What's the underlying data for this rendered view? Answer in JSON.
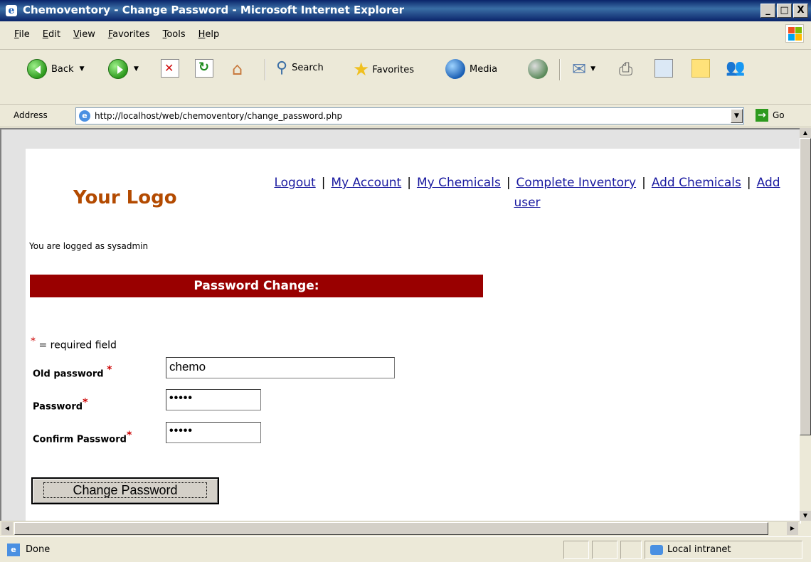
{
  "window": {
    "title": "Chemoventory - Change Password - Microsoft Internet Explorer",
    "minimize": "_",
    "maximize": "□",
    "close": "X"
  },
  "menu": [
    "File",
    "Edit",
    "View",
    "Favorites",
    "Tools",
    "Help"
  ],
  "toolbar": {
    "back": "Back",
    "search": "Search",
    "favorites": "Favorites",
    "media": "Media"
  },
  "address": {
    "label": "Address",
    "url": "http://localhost/web/chemoventory/change_password.php",
    "go": "Go"
  },
  "page": {
    "logo": "Your Logo",
    "nav": [
      "Logout",
      "My Account",
      "My Chemicals",
      "Complete Inventory",
      "Add Chemicals",
      "Add user"
    ],
    "logged_in": "You are logged as sysadmin",
    "heading": "Password Change:",
    "required_note": " = required field",
    "required_star": "*",
    "fields": {
      "old_password_label": "Old password",
      "old_password_value": "chemo",
      "password_label": "Password",
      "password_value": "•••••",
      "confirm_label": "Confirm Password",
      "confirm_value": "•••••"
    },
    "submit": "Change Password"
  },
  "status": {
    "text": "Done",
    "zone": "Local intranet"
  },
  "colors": {
    "heading_band": "#990000",
    "logo": "#b34a00",
    "link": "#1a1aa0"
  }
}
